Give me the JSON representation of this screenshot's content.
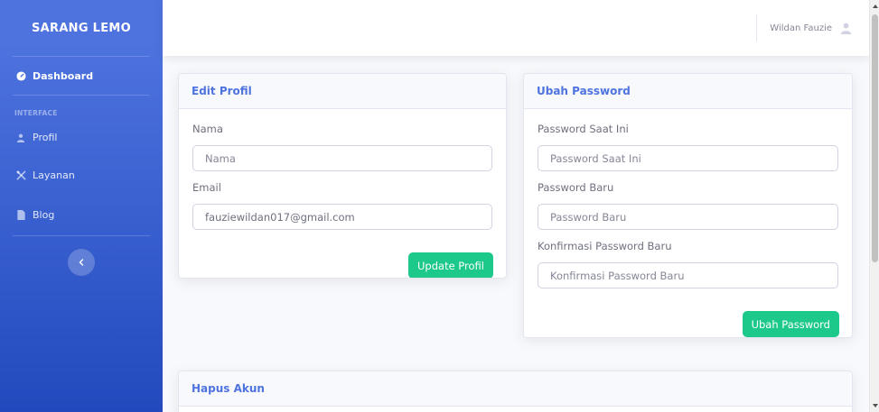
{
  "sidebar": {
    "brand": "SARANG LEMO",
    "dashboard": "Dashboard",
    "heading": "INTERFACE",
    "items": [
      {
        "label": "Profil",
        "icon": "user-icon"
      },
      {
        "label": "Layanan",
        "icon": "tools-icon"
      },
      {
        "label": "Blog",
        "icon": "file-icon"
      }
    ],
    "toggle_icon": "chevron-left-icon"
  },
  "topbar": {
    "user_name": "Wildan Fauzie",
    "avatar_icon": "user-icon"
  },
  "edit_profile": {
    "title": "Edit Profil",
    "name_label": "Nama",
    "name_placeholder": "Nama",
    "email_label": "Email",
    "email_value": "fauziewildan017@gmail.com",
    "button": "Update Profil"
  },
  "change_password": {
    "title": "Ubah Password",
    "current_label": "Password Saat Ini",
    "current_placeholder": "Password Saat Ini",
    "new_label": "Password Baru",
    "new_placeholder": "Password Baru",
    "confirm_label": "Konfirmasi Password Baru",
    "confirm_placeholder": "Konfirmasi Password Baru",
    "button": "Ubah Password"
  },
  "delete_account": {
    "title": "Hapus Akun"
  },
  "colors": {
    "primary": "#4e73df",
    "success": "#1cc88a",
    "sidebar_end": "#224abe"
  }
}
